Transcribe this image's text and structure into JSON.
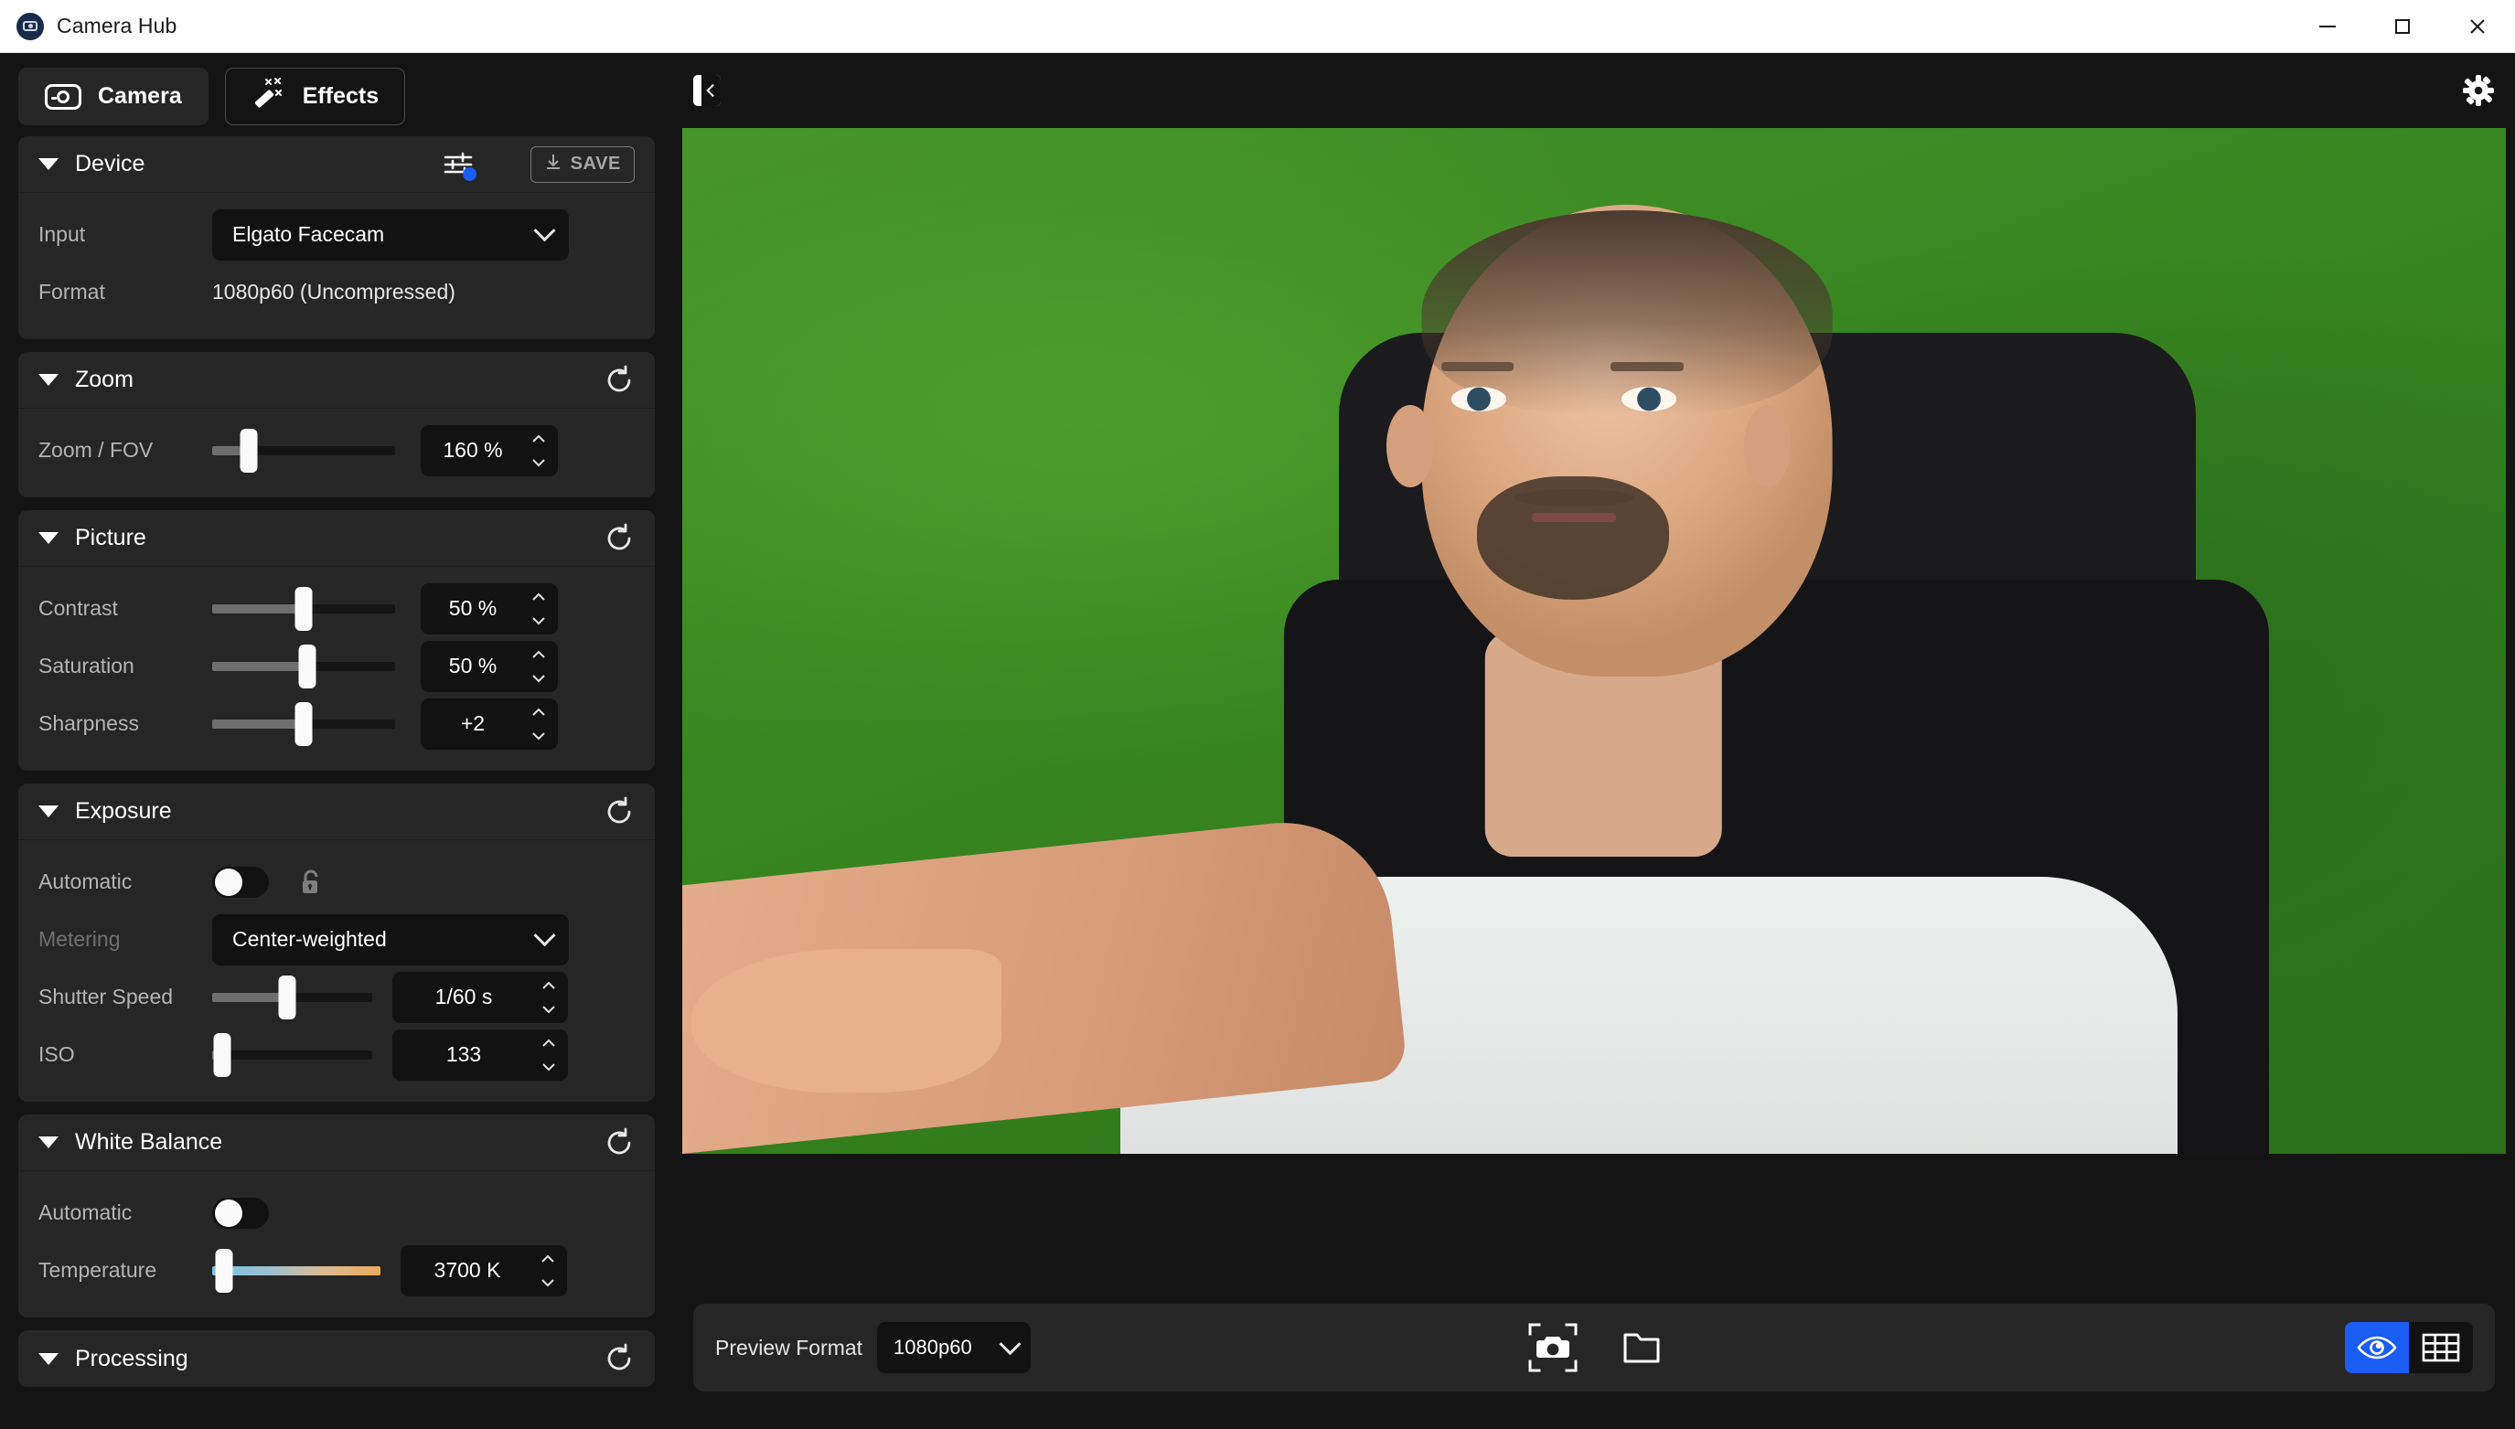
{
  "window": {
    "title": "Camera Hub",
    "app_icon": "camera-hub-logo-icon",
    "minimize": "minimize-icon",
    "maximize": "maximize-icon",
    "close": "close-icon"
  },
  "tabs": [
    {
      "label": "Camera",
      "icon": "camera-icon",
      "active": true
    },
    {
      "label": "Effects",
      "icon": "magic-wand-icon",
      "active": false
    }
  ],
  "sections": {
    "device": {
      "title": "Device",
      "eq_icon": "equalizer-icon",
      "save_label": "SAVE",
      "save_icon": "download-icon",
      "input": {
        "label": "Input",
        "value": "Elgato Facecam"
      },
      "format": {
        "label": "Format",
        "value": "1080p60 (Uncompressed)"
      }
    },
    "zoom": {
      "title": "Zoom",
      "reset_icon": "reset-icon",
      "rows": [
        {
          "label": "Zoom / FOV",
          "value": "160 %",
          "fill_pct": 23,
          "knob_pct": 20
        }
      ]
    },
    "picture": {
      "title": "Picture",
      "reset_icon": "reset-icon",
      "rows": [
        {
          "label": "Contrast",
          "value": "50 %",
          "fill_pct": 50,
          "knob_pct": 50
        },
        {
          "label": "Saturation",
          "value": "50 %",
          "fill_pct": 52,
          "knob_pct": 52
        },
        {
          "label": "Sharpness",
          "value": "+2",
          "fill_pct": 50,
          "knob_pct": 50
        }
      ]
    },
    "exposure": {
      "title": "Exposure",
      "reset_icon": "reset-icon",
      "automatic": {
        "label": "Automatic",
        "state": "off",
        "lock_icon": "unlock-icon"
      },
      "metering": {
        "label": "Metering",
        "value": "Center-weighted",
        "disabled": true
      },
      "rows": [
        {
          "label": "Shutter Speed",
          "value": "1/60 s",
          "fill_pct": 47,
          "knob_pct": 47
        },
        {
          "label": "ISO",
          "value": "133",
          "fill_pct": 6,
          "knob_pct": 6
        }
      ]
    },
    "white_balance": {
      "title": "White Balance",
      "reset_icon": "reset-icon",
      "automatic": {
        "label": "Automatic",
        "state": "off"
      },
      "temperature": {
        "label": "Temperature",
        "value": "3700 K",
        "knob_pct": 7
      }
    },
    "processing": {
      "title": "Processing",
      "reset_icon": "reset-icon"
    }
  },
  "preview": {
    "collapse_icon": "collapse-panel-icon",
    "settings_icon": "gear-icon",
    "toolbar": {
      "format_label": "Preview Format",
      "format_value": "1080p60",
      "snapshot_icon": "snapshot-camera-icon",
      "folder_icon": "folder-icon",
      "view_eye_icon": "eye-icon",
      "view_grid_icon": "grid-icon",
      "active_view": "eye"
    }
  },
  "colors": {
    "accent": "#1b5cf3",
    "panel": "#262626",
    "app_bg": "#141414",
    "field": "#121212",
    "text": "#ffffff",
    "text_dim": "#b4b4b4",
    "text_disabled": "#6f6f6f"
  }
}
